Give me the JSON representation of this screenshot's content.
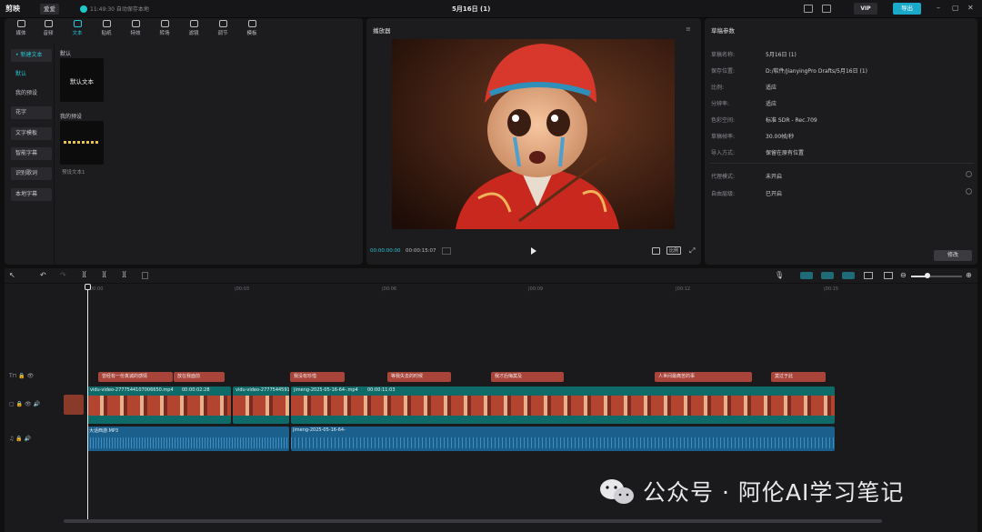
{
  "app": {
    "logo": "剪映",
    "user": "爱爱",
    "autosave": "11:49:30 自动保存本地",
    "doc_title": "5月16日 (1)",
    "vip": "VIP",
    "export": "导出"
  },
  "tabs": [
    {
      "label": "媒体",
      "icon": "media-icon"
    },
    {
      "label": "音频",
      "icon": "audio-icon"
    },
    {
      "label": "文本",
      "icon": "text-icon",
      "active": true
    },
    {
      "label": "贴纸",
      "icon": "sticker-icon"
    },
    {
      "label": "特效",
      "icon": "effect-icon"
    },
    {
      "label": "转场",
      "icon": "transition-icon"
    },
    {
      "label": "滤镜",
      "icon": "filter-icon"
    },
    {
      "label": "调节",
      "icon": "adjust-icon"
    },
    {
      "label": "模板",
      "icon": "template-icon"
    }
  ],
  "side": {
    "new_text": "• 新建文本",
    "default": "默认",
    "my_presets": "我的预设",
    "fancy": "花字",
    "template": "文字模板",
    "smart_sub": "智能字幕",
    "lyrics": "识别歌词",
    "local_sub": "本地字幕"
  },
  "library": {
    "default_group": "默认",
    "default_text": "默认文本",
    "my_group": "我的预设",
    "preset_name": "预设文本1"
  },
  "player": {
    "title": "播放器",
    "current_time": "00:00:00:00",
    "total_time": "00:00:15:07",
    "ratio": "比例"
  },
  "params": {
    "title": "草稿参数",
    "rows": [
      {
        "k": "草稿名称:",
        "v": "5月16日 (1)"
      },
      {
        "k": "保存位置:",
        "v": "D:/软件/JianyingPro Drafts/5月16日 (1)"
      },
      {
        "k": "比例:",
        "v": "适应"
      },
      {
        "k": "分辨率:",
        "v": "适应"
      },
      {
        "k": "色彩空间:",
        "v": "标准 SDR - Rec.709"
      },
      {
        "k": "草稿帧率:",
        "v": "30.00帧/秒"
      },
      {
        "k": "导入方式:",
        "v": "保留在原有位置"
      },
      {
        "k": "代理模式:",
        "v": "未开启"
      },
      {
        "k": "自由层级:",
        "v": "已开启"
      }
    ],
    "edit": "修改"
  },
  "timeline": {
    "ticks": [
      "00:00",
      "|00:03",
      "|00:06",
      "|00:09",
      "|00:12",
      "|00:15"
    ],
    "subtitles": [
      "曾经有一份真诚的感情",
      "放在我面前",
      "我没有珍惜",
      "等我失去的时候",
      "我才后悔莫及",
      "人世间最痛苦的事",
      "莫过于此"
    ],
    "video_clips": [
      {
        "name": "vidu-video-2777544107006650.mp4",
        "dur": "00:00:02:28"
      },
      {
        "name": "vidu-video-2777544591",
        "dur": ""
      },
      {
        "name": "jimeng-2025-05-16-64-.mp4",
        "dur": "00:00:11:03"
      }
    ],
    "audio_clips": [
      {
        "name": "大话西游.MP3"
      },
      {
        "name": "jimeng-2025-05-16-64-"
      }
    ]
  },
  "watermark": "公众号 · 阿伦AI学习笔记"
}
